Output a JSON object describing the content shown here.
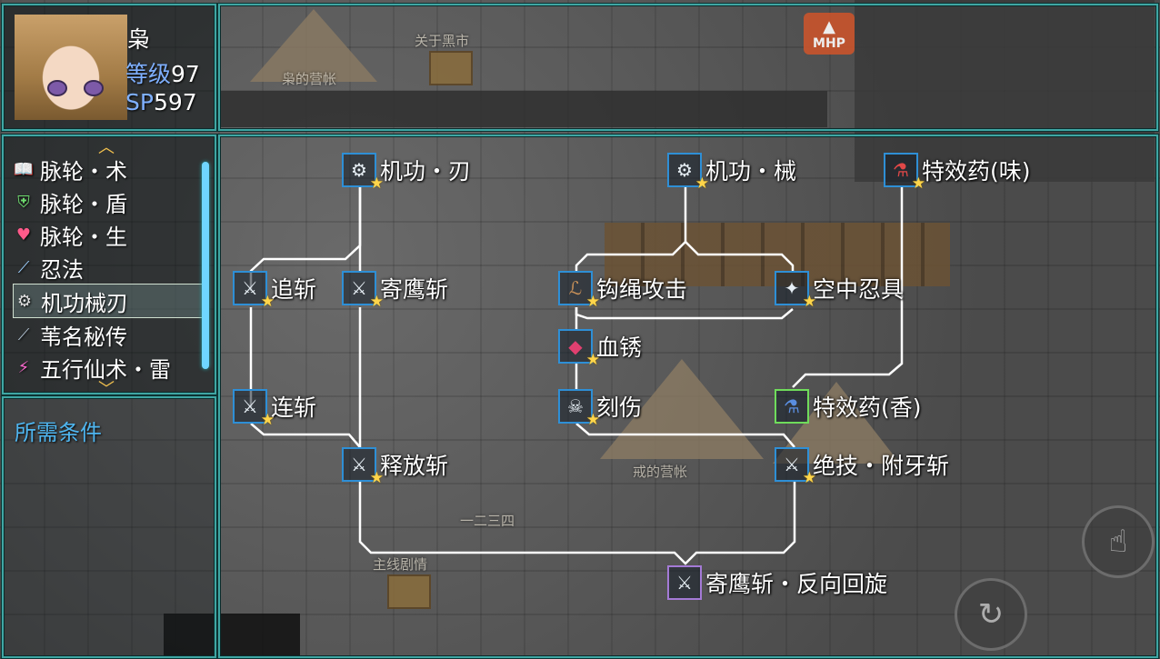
{
  "map_labels": {
    "tent_label_1": "枭的营帐",
    "sign_label": "关于黑市",
    "tent_label_2": "戒的营帐",
    "floor_label": "一二三四",
    "quest_label": "主线剧情"
  },
  "mhp_badge": "MHP",
  "character": {
    "name": "枭",
    "level_label": "等级",
    "level": "97",
    "sp_label": "SP",
    "sp": "597"
  },
  "skill_categories": [
    {
      "label": "脉轮・术",
      "icon": "book-icon",
      "selected": false
    },
    {
      "label": "脉轮・盾",
      "icon": "shield-heart-icon",
      "selected": false
    },
    {
      "label": "脉轮・生",
      "icon": "heart-icon",
      "selected": false
    },
    {
      "label": "忍法",
      "icon": "kunai-icon",
      "selected": false
    },
    {
      "label": "机功械刃",
      "icon": "gear-icon",
      "selected": true
    },
    {
      "label": "苇名秘传",
      "icon": "sword-icon",
      "selected": false
    },
    {
      "label": "五行仙术・雷",
      "icon": "lightning-icon",
      "selected": false
    }
  ],
  "requirements_label": "所需条件",
  "skill_tree": {
    "nodes": [
      {
        "id": "jigong-ren",
        "label": "机功・刃",
        "icon": "gear-icon",
        "learned": true
      },
      {
        "id": "jigong-xie",
        "label": "机功・械",
        "icon": "gear-icon",
        "learned": true
      },
      {
        "id": "potion-wei",
        "label": "特效药(味)",
        "icon": "potion-icon",
        "learned": true
      },
      {
        "id": "zhuizhan",
        "label": "追斩",
        "icon": "blade-icon",
        "learned": true
      },
      {
        "id": "jiyingzhan",
        "label": "寄鹰斩",
        "icon": "blade-icon",
        "learned": true
      },
      {
        "id": "goushengongji",
        "label": "钩绳攻击",
        "icon": "rope-icon",
        "learned": true
      },
      {
        "id": "kongzhongrenju",
        "label": "空中忍具",
        "icon": "shuriken-icon",
        "learned": true
      },
      {
        "id": "xuexiu",
        "label": "血锈",
        "icon": "gem-icon",
        "learned": true
      },
      {
        "id": "lianzhan",
        "label": "连斩",
        "icon": "blade-icon",
        "learned": true
      },
      {
        "id": "keshang",
        "label": "刻伤",
        "icon": "skull-icon",
        "learned": true
      },
      {
        "id": "potion-xiang",
        "label": "特效药(香)",
        "icon": "potion-icon",
        "learned": false
      },
      {
        "id": "shifangzhan",
        "label": "释放斩",
        "icon": "blade-icon",
        "learned": true
      },
      {
        "id": "juejifuyazhan",
        "label": "绝技・附牙斩",
        "icon": "blade-icon",
        "learned": true
      },
      {
        "id": "jiyingzhan-fanxiang",
        "label": "寄鹰斩・反向回旋",
        "icon": "blade-icon",
        "learned": false
      }
    ]
  },
  "buttons": {
    "touch": "touch-hand-icon",
    "cycle": "cycle-arrow-icon"
  }
}
